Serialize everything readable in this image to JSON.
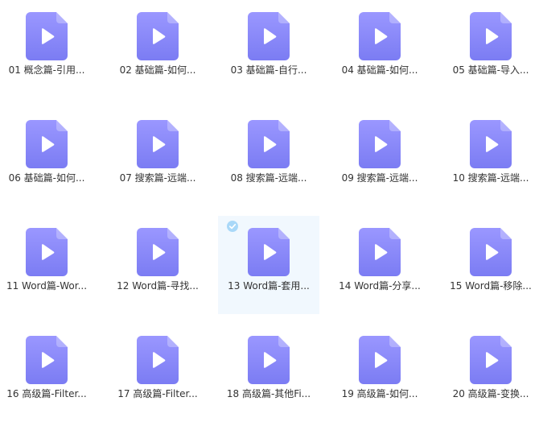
{
  "colors": {
    "icon_gradient_top": "#9a97ff",
    "icon_gradient_bottom": "#7b7cf3",
    "play_glyph": "#ffffff",
    "selected_background": "#f1f8fe",
    "check_badge": "#a9d8f8"
  },
  "files": [
    {
      "label": "01 概念篇-引用...",
      "icon": "video-file-icon",
      "selected": false
    },
    {
      "label": "02 基础篇-如何...",
      "icon": "video-file-icon",
      "selected": false
    },
    {
      "label": "03 基础篇-自行...",
      "icon": "video-file-icon",
      "selected": false
    },
    {
      "label": "04 基础篇-如何...",
      "icon": "video-file-icon",
      "selected": false
    },
    {
      "label": "05 基础篇-导入...",
      "icon": "video-file-icon",
      "selected": false
    },
    {
      "label": "06 基础篇-如何...",
      "icon": "video-file-icon",
      "selected": false
    },
    {
      "label": "07 搜索篇-远端...",
      "icon": "video-file-icon",
      "selected": false
    },
    {
      "label": "08 搜索篇-远端...",
      "icon": "video-file-icon",
      "selected": false
    },
    {
      "label": "09 搜索篇-远端...",
      "icon": "video-file-icon",
      "selected": false
    },
    {
      "label": "10 搜索篇-远端...",
      "icon": "video-file-icon",
      "selected": false
    },
    {
      "label": "11 Word篇-Wor...",
      "icon": "video-file-icon",
      "selected": false
    },
    {
      "label": "12 Word篇-寻找...",
      "icon": "video-file-icon",
      "selected": false
    },
    {
      "label": "13 Word篇-套用...",
      "icon": "video-file-icon",
      "selected": true
    },
    {
      "label": "14 Word篇-分享...",
      "icon": "video-file-icon",
      "selected": false
    },
    {
      "label": "15 Word篇-移除...",
      "icon": "video-file-icon",
      "selected": false
    },
    {
      "label": "16 高级篇-Filter...",
      "icon": "video-file-icon",
      "selected": false
    },
    {
      "label": "17 高级篇-Filter...",
      "icon": "video-file-icon",
      "selected": false
    },
    {
      "label": "18 高级篇-其他Fi...",
      "icon": "video-file-icon",
      "selected": false
    },
    {
      "label": "19 高级篇-如何...",
      "icon": "video-file-icon",
      "selected": false
    },
    {
      "label": "20 高级篇-变换...",
      "icon": "video-file-icon",
      "selected": false
    }
  ]
}
